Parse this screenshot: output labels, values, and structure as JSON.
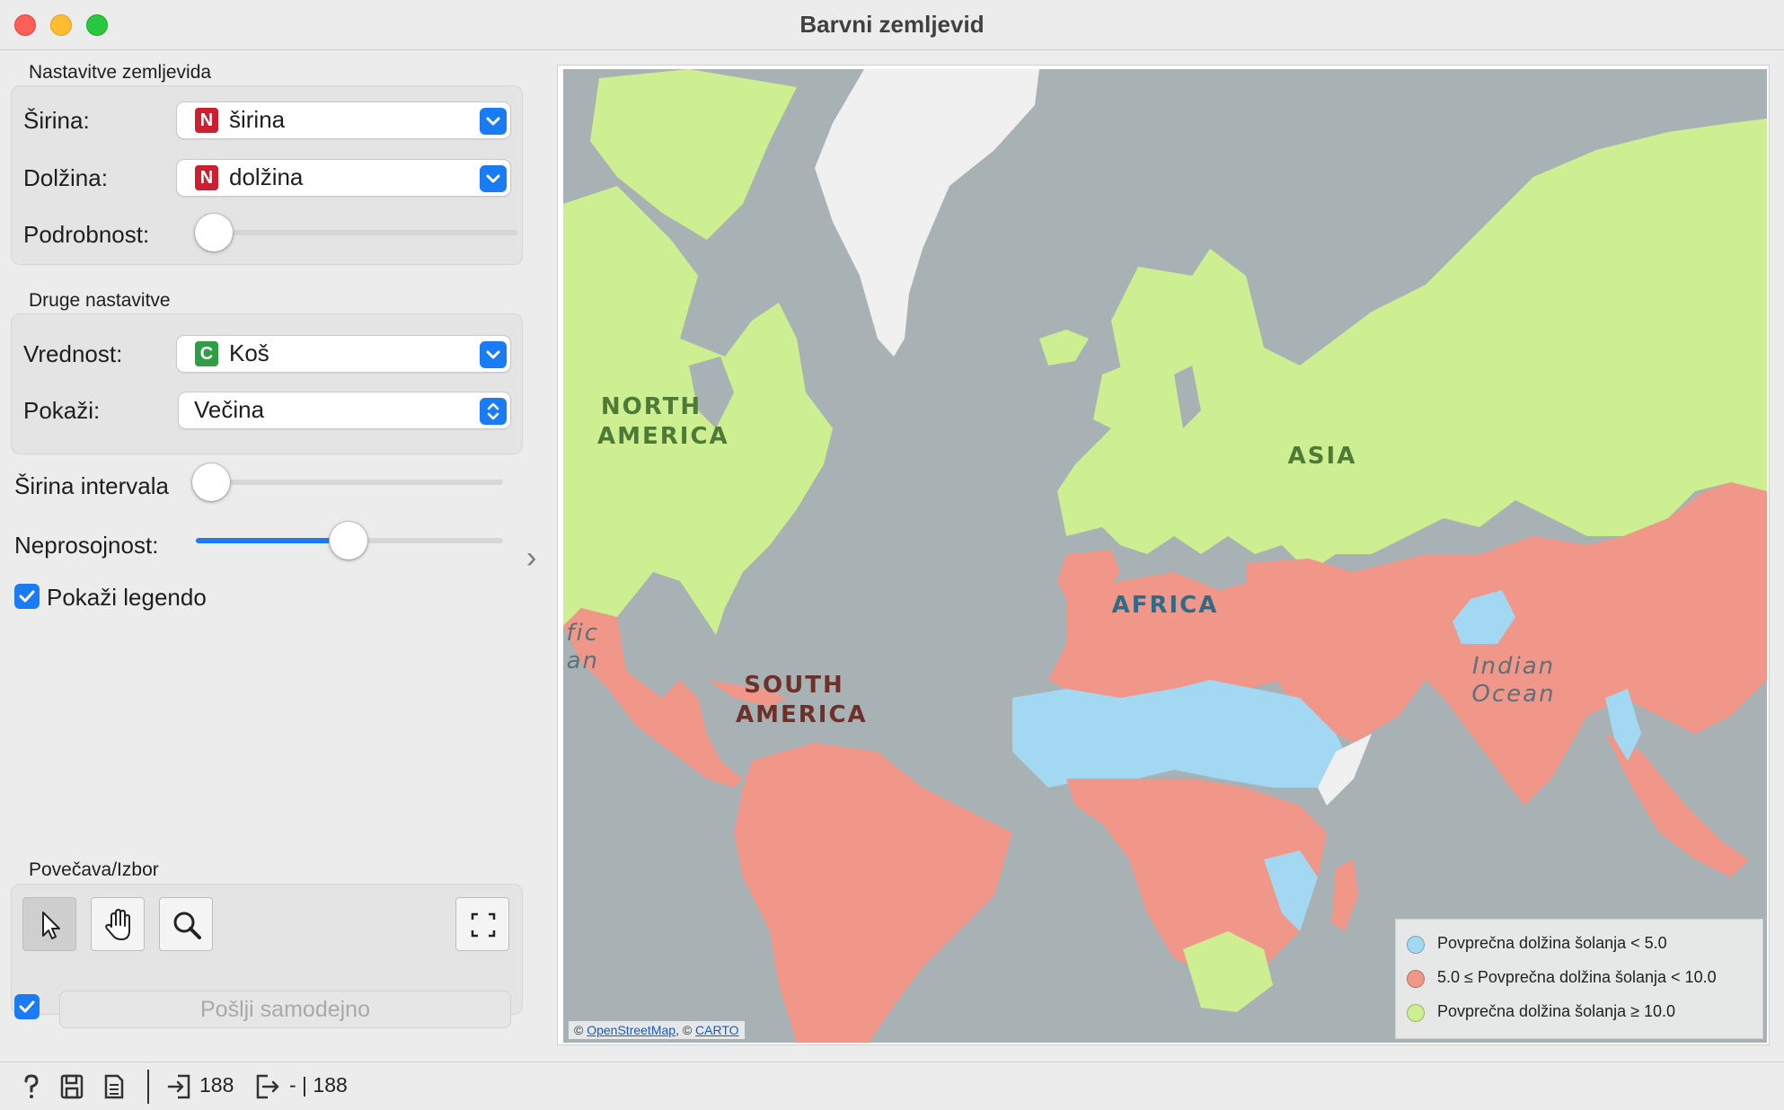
{
  "window": {
    "title": "Barvni zemljevid"
  },
  "map_settings": {
    "section_title": "Nastavitve zemljevida",
    "latitude": {
      "label": "Širina:",
      "badge": "N",
      "badge_color": "#cc1f2f",
      "value": "širina"
    },
    "longitude": {
      "label": "Dolžina:",
      "badge": "N",
      "badge_color": "#cc1f2f",
      "value": "dolžina"
    },
    "detail": {
      "label": "Podrobnost:",
      "level": 0
    }
  },
  "other_settings": {
    "section_title": "Druge nastavitve",
    "value": {
      "label": "Vrednost:",
      "badge": "C",
      "badge_color": "#2f9e44",
      "value": "Koš"
    },
    "show": {
      "label": "Pokaži:",
      "value": "Večina"
    }
  },
  "bin_width": {
    "label": "Širina intervala",
    "level": 0
  },
  "opacity": {
    "label": "Neprosojnost:",
    "level": 0.5
  },
  "show_legend": {
    "label": "Pokaži legendo",
    "checked": true
  },
  "zoom_select": {
    "section_title": "Povečava/Izbor",
    "tools": [
      "pointer-icon",
      "hand-icon",
      "magnifier-icon",
      "fullscreen-icon"
    ]
  },
  "send": {
    "auto_checked": true,
    "label": "Pošlji samodejno"
  },
  "map": {
    "continent_labels": {
      "north_america": "NORTH AMERICA",
      "south_america": "SOUTH AMERICA",
      "africa": "AFRICA",
      "asia": "ASIA"
    },
    "ocean_labels": {
      "pacific": "fic an",
      "indian": "Indian Ocean"
    },
    "attribution": {
      "prefix": "© ",
      "osm": "OpenStreetMap",
      "sep": ", © ",
      "carto": "CARTO"
    },
    "colors": {
      "ocean": "#a8b2b4",
      "low": "#a3d8f2",
      "mid": "#f1978a",
      "high": "#cdee91",
      "no_data": "#f0f0f0"
    },
    "legend": [
      {
        "color": "#a3d8f2",
        "label": "Povprečna dolžina šolanja < 5.0"
      },
      {
        "color": "#f1978a",
        "label": "5.0 ≤ Povprečna dolžina šolanja < 10.0"
      },
      {
        "color": "#cdee91",
        "label": "Povprečna dolžina šolanja ≥ 10.0"
      }
    ]
  },
  "status": {
    "input_count": "188",
    "output_count": "- | 188"
  }
}
